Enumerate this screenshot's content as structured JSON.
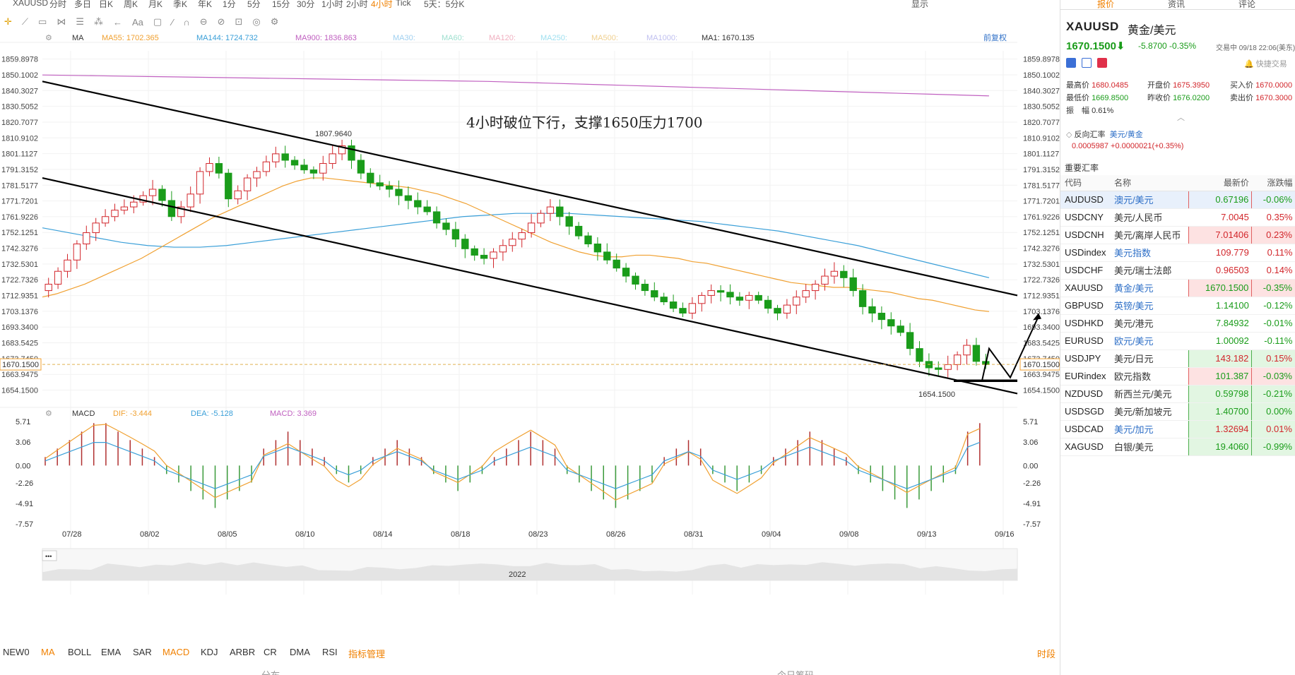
{
  "topbar": {
    "symbol": "XAUUSD",
    "periods": [
      "分时",
      "多日",
      "日K",
      "周K",
      "月K",
      "季K",
      "年K",
      "1分",
      "5分",
      "15分",
      "30分",
      "1小时",
      "2小时",
      "4小时",
      "Tick"
    ],
    "active_period": "4小时",
    "range": "5天：5分K",
    "display": "显示"
  },
  "ma_bar": {
    "label": "MA",
    "items": [
      {
        "text": "MA55: 1702.365",
        "color": "#f0a030"
      },
      {
        "text": "MA144: 1724.732",
        "color": "#3a9fd8"
      },
      {
        "text": "MA900: 1836.863",
        "color": "#c060c0"
      },
      {
        "text": "MA30:",
        "color": "#a0d0f0"
      },
      {
        "text": "MA60:",
        "color": "#a0e0d0"
      },
      {
        "text": "MA120:",
        "color": "#f0b0c0"
      },
      {
        "text": "MA250:",
        "color": "#a0e0f0"
      },
      {
        "text": "MA500:",
        "color": "#f0d090"
      },
      {
        "text": "MA1000:",
        "color": "#c0c0f0"
      },
      {
        "text": "MA1: 1670.135",
        "color": "#333333"
      }
    ],
    "adjust": "前复权"
  },
  "chart_data": {
    "type": "candlestick",
    "annotation": "4小时破位下行，支撑1650压力1700",
    "price_labels": [
      "1859.8978",
      "1850.1002",
      "1840.3027",
      "1830.5052",
      "1820.7077",
      "1810.9102",
      "1801.1127",
      "1791.3152",
      "1781.5177",
      "1771.7201",
      "1761.9226",
      "1752.1251",
      "1742.3276",
      "1732.5301",
      "1722.7326",
      "1712.9351",
      "1703.1376",
      "1693.3400",
      "1683.5425",
      "1673.7450",
      "1663.9475",
      "1654.1500"
    ],
    "ylim": [
      1650,
      1865
    ],
    "current_price": "1670.1500",
    "high_label": "1807.9640",
    "low_label": "1654.1500",
    "x_labels": [
      "07/28",
      "08/02",
      "08/05",
      "08/10",
      "08/14",
      "08/18",
      "08/23",
      "08/26",
      "08/31",
      "09/04",
      "09/08",
      "09/13",
      "09/16"
    ],
    "year_label": "2022",
    "ohlc_close": [
      1720,
      1728,
      1735,
      1745,
      1752,
      1758,
      1762,
      1766,
      1768,
      1771,
      1775,
      1779,
      1772,
      1762,
      1768,
      1776,
      1790,
      1795,
      1789,
      1773,
      1778,
      1786,
      1790,
      1796,
      1801,
      1797,
      1794,
      1791,
      1789,
      1795,
      1801,
      1806,
      1797,
      1789,
      1783,
      1781,
      1779,
      1775,
      1772,
      1768,
      1765,
      1758,
      1754,
      1748,
      1742,
      1738,
      1736,
      1740,
      1744,
      1748,
      1752,
      1758,
      1764,
      1768,
      1762,
      1756,
      1750,
      1745,
      1740,
      1735,
      1730,
      1725,
      1720,
      1716,
      1712,
      1709,
      1705,
      1702,
      1708,
      1713,
      1716,
      1715,
      1712,
      1710,
      1713,
      1710,
      1705,
      1702,
      1707,
      1712,
      1716,
      1720,
      1725,
      1728,
      1724,
      1716,
      1706,
      1702,
      1698,
      1694,
      1690,
      1680,
      1672,
      1668,
      1667,
      1670,
      1676,
      1682,
      1672,
      1670
    ],
    "ma55": [
      1712,
      1714,
      1717,
      1720,
      1724,
      1728,
      1732,
      1736,
      1741,
      1746,
      1751,
      1756,
      1761,
      1765,
      1769,
      1773,
      1777,
      1781,
      1784,
      1786,
      1786,
      1785,
      1784,
      1783,
      1782,
      1781,
      1780,
      1778,
      1776,
      1773,
      1770,
      1766,
      1762,
      1758,
      1754,
      1750,
      1746,
      1743,
      1740,
      1738,
      1737,
      1737,
      1738,
      1738,
      1737,
      1736,
      1734,
      1733,
      1731,
      1729,
      1727,
      1725,
      1723,
      1721,
      1720,
      1719,
      1718,
      1718,
      1717,
      1716,
      1715,
      1713,
      1711,
      1710,
      1708,
      1706,
      1704,
      1703
    ],
    "ma144": [
      1755,
      1752,
      1749,
      1746,
      1744,
      1743,
      1743,
      1744,
      1746,
      1748,
      1750,
      1752,
      1754,
      1756,
      1758,
      1760,
      1762,
      1763,
      1764,
      1764,
      1764,
      1763,
      1762,
      1761,
      1760,
      1759,
      1757,
      1755,
      1753,
      1750,
      1747,
      1744,
      1740,
      1736,
      1732,
      1728,
      1724
    ],
    "ma900": [
      1850,
      1849.5,
      1849,
      1848.5,
      1848,
      1847.5,
      1847,
      1846.5,
      1846,
      1845,
      1844,
      1843,
      1842,
      1841,
      1840,
      1839,
      1838,
      1837
    ],
    "channel_upper": {
      "from": [
        1718,
        1846
      ],
      "to": [
        1716,
        1713
      ]
    },
    "channel_lower": {
      "from": [
        1730,
        1786
      ],
      "to": [
        1655,
        1652
      ]
    }
  },
  "macd_bar": {
    "label": "MACD",
    "dif": "DIF: -3.444",
    "dea": "DEA: -5.128",
    "macd": "MACD: 3.369",
    "y_labels": [
      "5.71",
      "3.06",
      "0.00",
      "-2.26",
      "-4.91",
      "-7.57"
    ],
    "hist": [
      1,
      2,
      3,
      4,
      5,
      5,
      4,
      3,
      2,
      1,
      -1,
      -2,
      -3,
      -4,
      -5,
      -4,
      -3,
      -2,
      2,
      3,
      4,
      3,
      2,
      1,
      -1,
      -2,
      -1,
      1,
      2,
      3,
      2,
      1,
      -1,
      -2,
      -3,
      -2,
      -1,
      1,
      2,
      3,
      4,
      3,
      2,
      -1,
      -2,
      -3,
      -4,
      -5,
      -4,
      -3,
      -2,
      1,
      2,
      3,
      2,
      -1,
      -2,
      -3,
      -2,
      -1,
      1,
      2,
      3,
      4,
      3,
      2,
      1,
      -1,
      -2,
      -3,
      -4,
      -5,
      -4,
      -3,
      -2,
      -1,
      4,
      5
    ]
  },
  "bottom_tabs": [
    "NEW0",
    "MA",
    "BOLL",
    "EMA",
    "SAR",
    "MACD",
    "KDJ",
    "ARBR",
    "CR",
    "DMA",
    "RSI",
    "指标管理"
  ],
  "bottom_right": "时段",
  "bottom_labels": [
    "分布",
    "今日筹码"
  ],
  "side": {
    "tabs": [
      "报价",
      "资讯",
      "评论"
    ],
    "symbol": "XAUUSD",
    "symbol_cn": "黄金/美元",
    "price": "1670.1500",
    "change": "-5.8700 -0.35%",
    "trade_status": "交易中 09/18 22:06(美东)",
    "quick_trade": "快捷交易",
    "stats": [
      {
        "label": "最高价",
        "value": "1680.0485"
      },
      {
        "label": "开盘价",
        "value": "1675.3950"
      },
      {
        "label": "买入价",
        "value": "1670.0000"
      },
      {
        "label": "最低价",
        "value": "1669.8500"
      },
      {
        "label": "昨收价",
        "value": "1676.0200"
      },
      {
        "label": "卖出价",
        "value": "1670.3000"
      },
      {
        "label": "振　幅",
        "value": "0.61%"
      }
    ],
    "reverse_label": "反向汇率",
    "reverse_pair": "美元/黄金",
    "reverse_value": "0.0005987 +0.0000021(+0.35%)",
    "section": "重要汇率",
    "columns": [
      "代码",
      "名称",
      "最新价",
      "涨跌幅"
    ],
    "rows": [
      {
        "code": "AUDUSD",
        "name": "澳元/美元",
        "price": "0.67196",
        "chg": "-0.06%",
        "dir": "dn",
        "box": "r",
        "link": true
      },
      {
        "code": "USDCNY",
        "name": "美元/人民币",
        "price": "7.0045",
        "chg": "0.35%",
        "dir": "up",
        "box": "",
        "link": false
      },
      {
        "code": "USDCNH",
        "name": "美元/离岸人民币",
        "price": "7.01406",
        "chg": "0.23%",
        "dir": "up",
        "box": "r",
        "link": false
      },
      {
        "code": "USDindex",
        "name": "美元指数",
        "price": "109.779",
        "chg": "0.11%",
        "dir": "up",
        "box": "",
        "link": true
      },
      {
        "code": "USDCHF",
        "name": "美元/瑞士法郎",
        "price": "0.96503",
        "chg": "0.14%",
        "dir": "up",
        "box": "",
        "link": false
      },
      {
        "code": "XAUUSD",
        "name": "黄金/美元",
        "price": "1670.1500",
        "chg": "-0.35%",
        "dir": "dn",
        "box": "r",
        "link": true
      },
      {
        "code": "GBPUSD",
        "name": "英镑/美元",
        "price": "1.14100",
        "chg": "-0.12%",
        "dir": "dn",
        "box": "",
        "link": true
      },
      {
        "code": "USDHKD",
        "name": "美元/港元",
        "price": "7.84932",
        "chg": "-0.01%",
        "dir": "dn",
        "box": "",
        "link": false
      },
      {
        "code": "EURUSD",
        "name": "欧元/美元",
        "price": "1.00092",
        "chg": "-0.11%",
        "dir": "dn",
        "box": "",
        "link": true
      },
      {
        "code": "USDJPY",
        "name": "美元/日元",
        "price": "143.182",
        "chg": "0.15%",
        "dir": "up",
        "box": "g",
        "link": false
      },
      {
        "code": "EURindex",
        "name": "欧元指数",
        "price": "101.387",
        "chg": "-0.03%",
        "dir": "dn",
        "box": "r",
        "link": false
      },
      {
        "code": "NZDUSD",
        "name": "新西兰元/美元",
        "price": "0.59798",
        "chg": "-0.21%",
        "dir": "dn",
        "box": "g",
        "link": false
      },
      {
        "code": "USDSGD",
        "name": "美元/新加坡元",
        "price": "1.40700",
        "chg": "0.00%",
        "dir": "dn",
        "box": "g",
        "link": false
      },
      {
        "code": "USDCAD",
        "name": "美元/加元",
        "price": "1.32694",
        "chg": "0.01%",
        "dir": "up",
        "box": "g",
        "link": true
      },
      {
        "code": "XAGUSD",
        "name": "白银/美元",
        "price": "19.4060",
        "chg": "-0.99%",
        "dir": "dn",
        "box": "g",
        "link": false
      }
    ]
  }
}
